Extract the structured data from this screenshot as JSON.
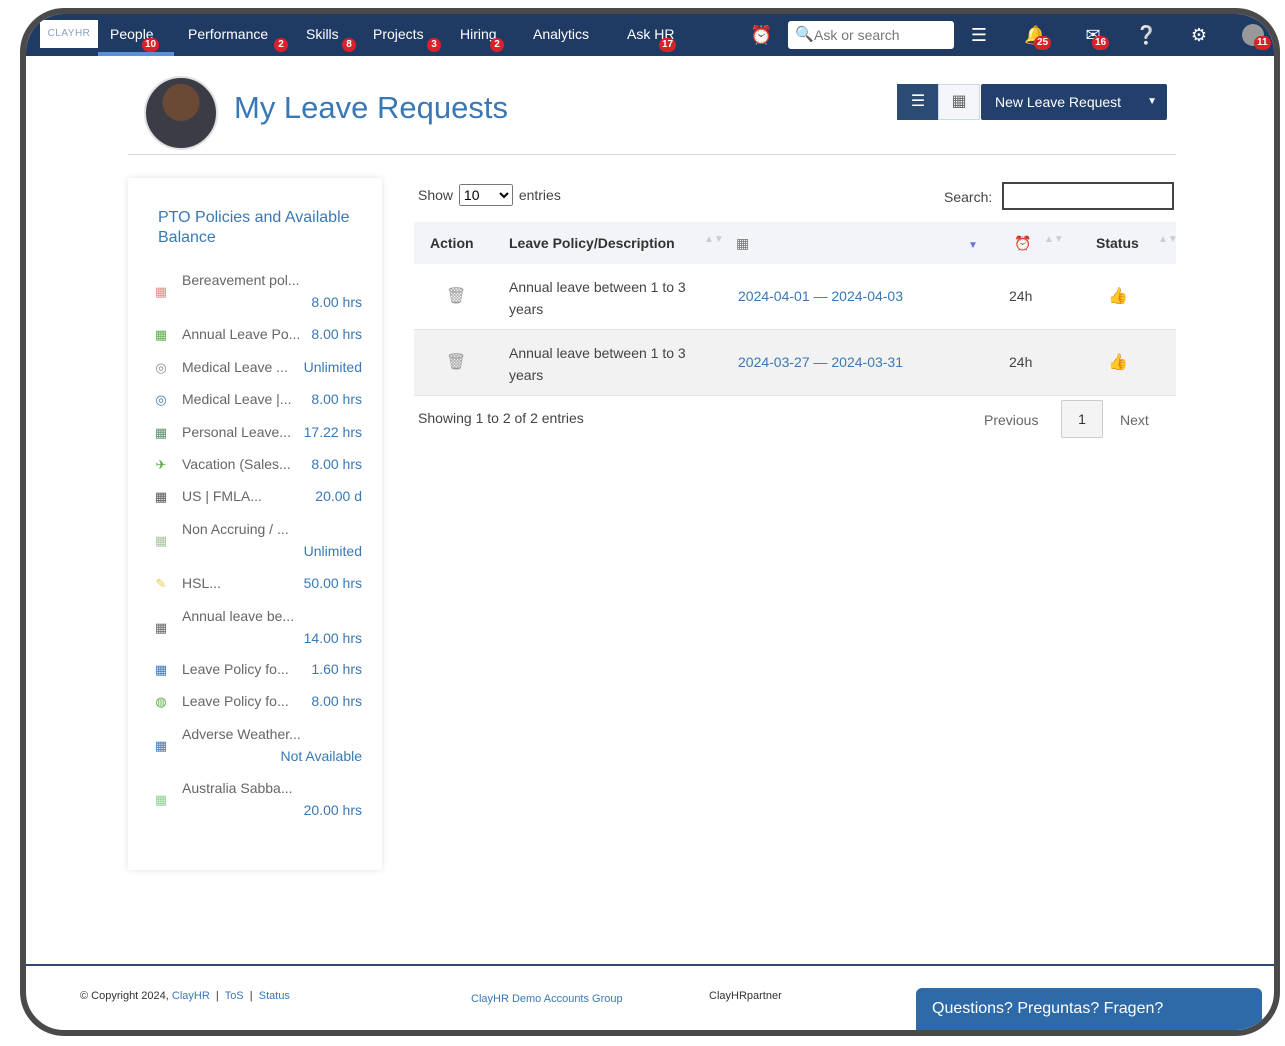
{
  "nav": {
    "logo": "CLAYHR",
    "items": [
      {
        "label": "People",
        "badge": "10"
      },
      {
        "label": "Performance",
        "badge": "2"
      },
      {
        "label": "Skills",
        "badge": "8"
      },
      {
        "label": "Projects",
        "badge": "3"
      },
      {
        "label": "Hiring",
        "badge": "2"
      },
      {
        "label": "Analytics",
        "badge": ""
      },
      {
        "label": "Ask HR",
        "badge": "17"
      }
    ],
    "search_placeholder": "Ask or search",
    "notifications_badge": "25",
    "messages_badge": "16",
    "avatar_badge": "11"
  },
  "header": {
    "title": "My Leave Requests",
    "new_button": "New Leave Request"
  },
  "panel": {
    "title": "PTO Policies and Available Balance",
    "policies": [
      {
        "name": "Bereavement pol...",
        "value": "8.00 hrs",
        "icon": "calendar-icon",
        "color": "#e58a8a"
      },
      {
        "name": "Annual Leave Po...",
        "value": "8.00 hrs",
        "icon": "calendar-icon",
        "color": "#5cae4a"
      },
      {
        "name": "Medical Leave ...",
        "value": "Unlimited",
        "icon": "camera-icon",
        "color": "#888888"
      },
      {
        "name": "Medical Leave |...",
        "value": "8.00 hrs",
        "icon": "camera-icon",
        "color": "#3a78b5"
      },
      {
        "name": "Personal Leave...",
        "value": "17.22 hrs",
        "icon": "calendar-icon",
        "color": "#5a8f6a"
      },
      {
        "name": "Vacation (Sales...",
        "value": "8.00 hrs",
        "icon": "airplane-icon",
        "color": "#5cae4a"
      },
      {
        "name": "US | FMLA...",
        "value": "20.00 d",
        "icon": "calendar-icon",
        "color": "#555555"
      },
      {
        "name": "Non Accruing / ...",
        "value": "Unlimited",
        "icon": "calendar-icon",
        "color": "#a9c4a0"
      },
      {
        "name": "HSL...",
        "value": "50.00 hrs",
        "icon": "pencil-icon",
        "color": "#e6c84a"
      },
      {
        "name": "Annual leave be...",
        "value": "14.00 hrs",
        "icon": "calendar-icon",
        "color": "#666666"
      },
      {
        "name": "Leave Policy fo...",
        "value": "1.60 hrs",
        "icon": "calendar-icon",
        "color": "#3a78b5"
      },
      {
        "name": "Leave Policy fo...",
        "value": "8.00 hrs",
        "icon": "globe-icon",
        "color": "#5cae4a"
      },
      {
        "name": "Adverse Weather...",
        "value": "Not Available",
        "icon": "calendar-icon",
        "color": "#3a78b5"
      },
      {
        "name": "Australia Sabba...",
        "value": "20.00 hrs",
        "icon": "calendar-icon",
        "color": "#8fd08f"
      }
    ]
  },
  "table": {
    "show_label": "Show",
    "entries_label": "entries",
    "page_size": "10",
    "search_label": "Search:",
    "headers": {
      "action": "Action",
      "policy": "Leave Policy/Description",
      "status": "Status"
    },
    "rows": [
      {
        "desc_line1": "Annual leave between 1 to 3",
        "desc_line2": "years",
        "dates": "2024-04-01 — 2024-04-03",
        "duration": "24h"
      },
      {
        "desc_line1": "Annual leave between 1 to 3",
        "desc_line2": "years",
        "dates": "2024-03-27 — 2024-03-31",
        "duration": "24h"
      }
    ],
    "info": "Showing 1 to 2 of 2 entries",
    "prev": "Previous",
    "page": "1",
    "next": "Next"
  },
  "footer": {
    "copyright": "© Copyright 2024,",
    "company": "ClayHR",
    "tos": "ToS",
    "status": "Status",
    "group": "ClayHR Demo Accounts Group",
    "partner": "ClayHRpartner",
    "chat": "Questions? Preguntas? Fragen?"
  }
}
